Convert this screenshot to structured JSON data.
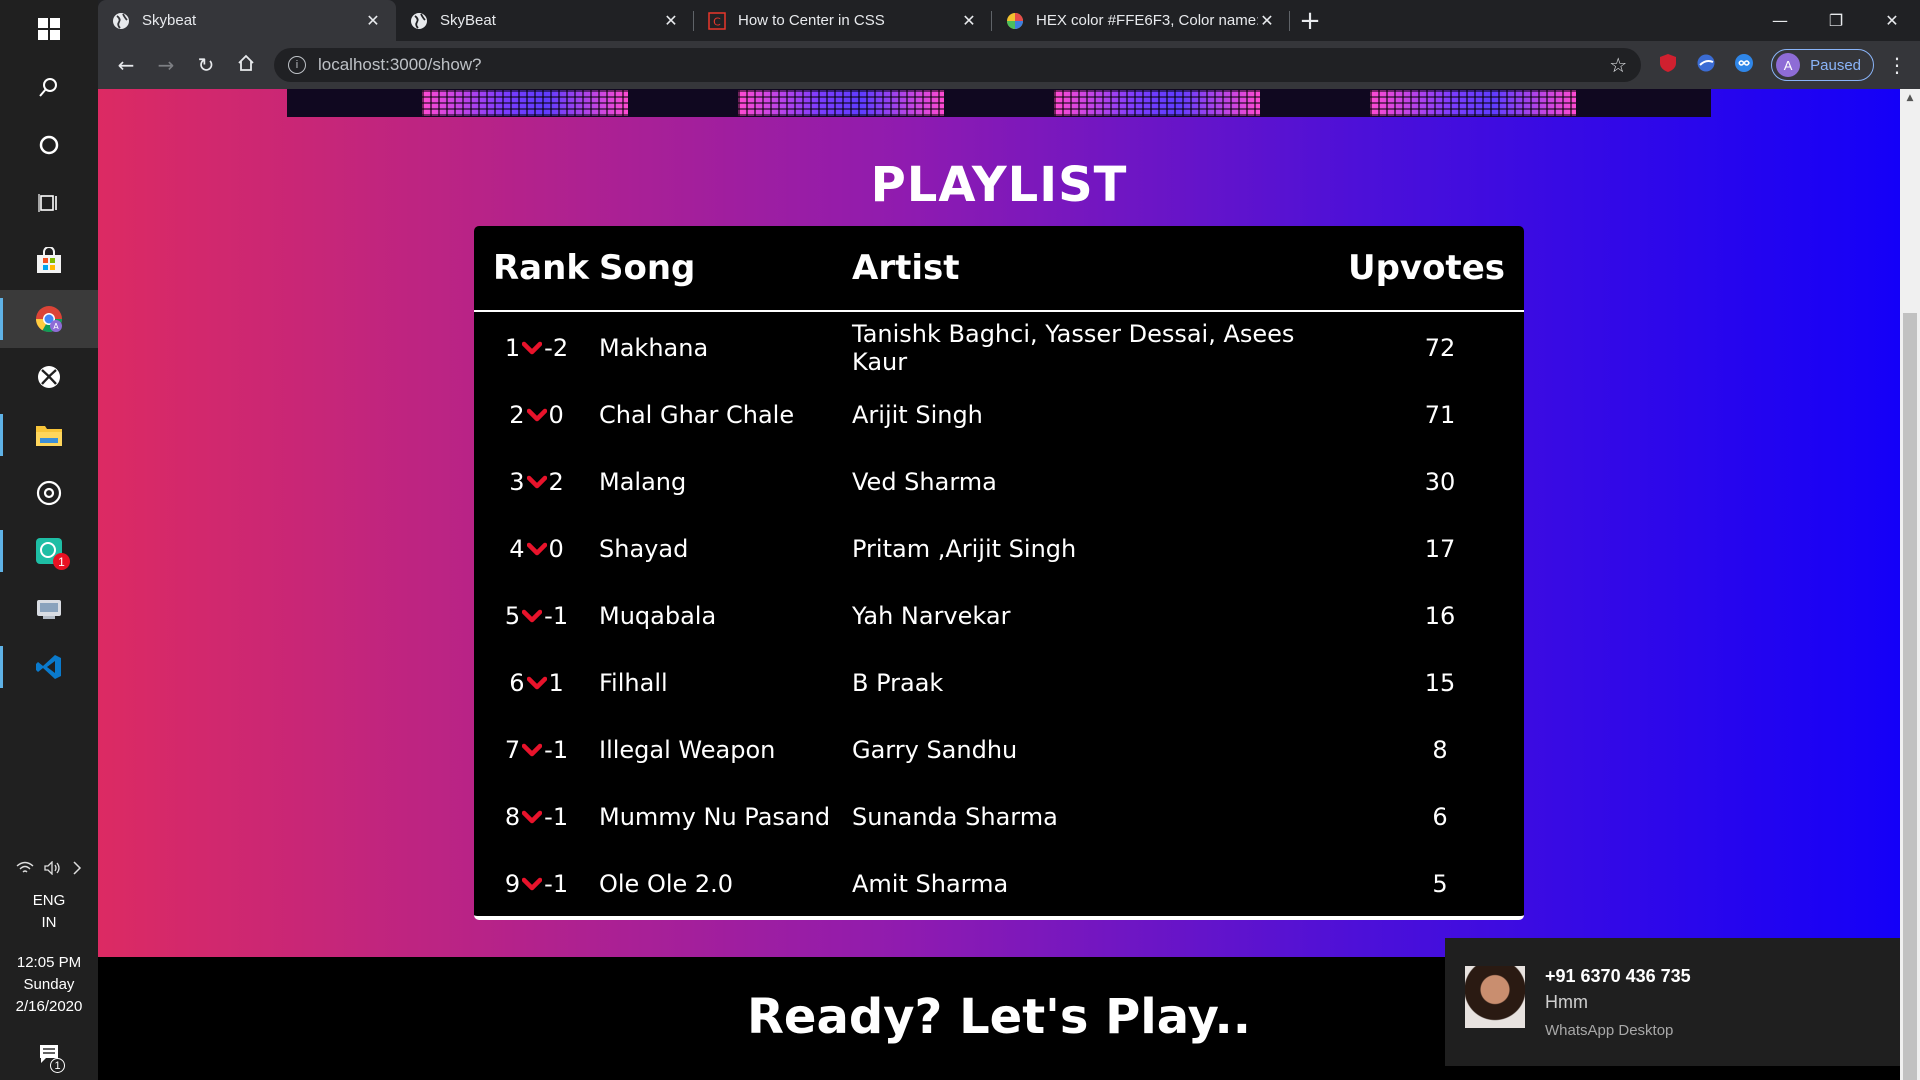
{
  "taskbar": {
    "apps": [
      {
        "icon": "windows-start-icon",
        "active": false,
        "running": false
      },
      {
        "icon": "search-icon",
        "active": false,
        "running": false
      },
      {
        "icon": "cortana-icon",
        "active": false,
        "running": false
      },
      {
        "icon": "task-view-icon",
        "active": false,
        "running": false
      },
      {
        "icon": "store-icon",
        "active": false,
        "running": false
      },
      {
        "icon": "chrome-icon",
        "active": true,
        "running": true
      },
      {
        "icon": "xbox-icon",
        "active": false,
        "running": false
      },
      {
        "icon": "file-explorer-icon",
        "active": false,
        "running": true
      },
      {
        "icon": "groove-music-icon",
        "active": false,
        "running": false
      },
      {
        "icon": "whatsapp-icon",
        "active": false,
        "running": true
      },
      {
        "icon": "mail-icon",
        "active": false,
        "running": false
      },
      {
        "icon": "vscode-icon",
        "active": false,
        "running": true
      }
    ],
    "tray": {
      "lang_line1": "ENG",
      "lang_line2": "IN",
      "time": "12:05 PM",
      "day": "Sunday",
      "date": "2/16/2020",
      "notification_count": "1",
      "whatsapp_badge": "1"
    }
  },
  "browser": {
    "tabs": [
      {
        "title": "Skybeat",
        "active": true
      },
      {
        "title": "SkyBeat",
        "active": false
      },
      {
        "title": "How to Center in CSS",
        "active": false
      },
      {
        "title": "HEX color #FFE6F3, Color name:",
        "active": false
      }
    ],
    "url": "localhost:3000/show?",
    "profile_initial": "A",
    "profile_label": "Paused"
  },
  "page": {
    "title": "PLAYLIST",
    "footer": "Ready? Let's Play..",
    "table": {
      "headers": {
        "rank": "Rank",
        "song": "Song",
        "artist": "Artist",
        "upvotes": "Upvotes"
      },
      "rows": [
        {
          "rank": "1",
          "change": "-2",
          "song": "Makhana",
          "artist": "Tanishk Baghci, Yasser Dessai, Asees Kaur",
          "upvotes": "72"
        },
        {
          "rank": "2",
          "change": "0",
          "song": "Chal Ghar Chale",
          "artist": "Arijit Singh",
          "upvotes": "71"
        },
        {
          "rank": "3",
          "change": "2",
          "song": "Malang",
          "artist": "Ved Sharma",
          "upvotes": "30"
        },
        {
          "rank": "4",
          "change": "0",
          "song": "Shayad",
          "artist": "Pritam ,Arijit Singh",
          "upvotes": "17"
        },
        {
          "rank": "5",
          "change": "-1",
          "song": "Muqabala",
          "artist": "Yah Narvekar",
          "upvotes": "16"
        },
        {
          "rank": "6",
          "change": "1",
          "song": "Filhall",
          "artist": "B Praak",
          "upvotes": "15"
        },
        {
          "rank": "7",
          "change": "-1",
          "song": "Illegal Weapon",
          "artist": "Garry Sandhu",
          "upvotes": "8"
        },
        {
          "rank": "8",
          "change": "-1",
          "song": "Mummy Nu Pasand",
          "artist": "Sunanda Sharma",
          "upvotes": "6"
        },
        {
          "rank": "9",
          "change": "-1",
          "song": "Ole Ole 2.0",
          "artist": "Amit Sharma",
          "upvotes": "5"
        }
      ]
    }
  },
  "toast": {
    "sender": "+91 6370 436 735",
    "message": "Hmm",
    "app": "WhatsApp Desktop"
  },
  "colors": {
    "gradient_start": "#dc2a63",
    "gradient_end": "#1400f8",
    "chevron": "#e8132b",
    "table_bg": "#000000"
  }
}
